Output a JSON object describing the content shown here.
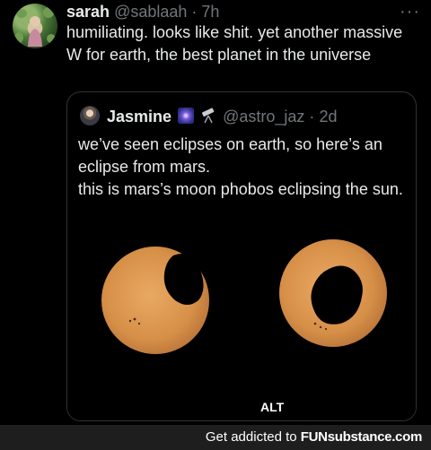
{
  "tweet": {
    "name": "sarah",
    "handle": "@sablaah",
    "separator": "·",
    "time": "7h",
    "more_label": "···",
    "text": "humiliating. looks like shit. yet another massive W for earth, the best planet in the universe"
  },
  "quote": {
    "name": "Jasmine",
    "handle": "@astro_jaz",
    "separator": "·",
    "time": "2d",
    "emoji": [
      "galaxy-icon",
      "telescope-icon"
    ],
    "lines": [
      "we’ve seen eclipses on earth, so here’s an eclipse from mars.",
      "this is mars’s moon phobos eclipsing the sun."
    ],
    "media_badge": "ALT"
  },
  "footer": {
    "prefix": "Get addicted to",
    "brand": "FUNsubstance.com"
  },
  "colors": {
    "background": "#000000",
    "text": "#e7e9ea",
    "muted": "#71767b",
    "border": "#2f3336",
    "sun": "#dd9a55",
    "footer_bg": "#1e1e1e"
  }
}
